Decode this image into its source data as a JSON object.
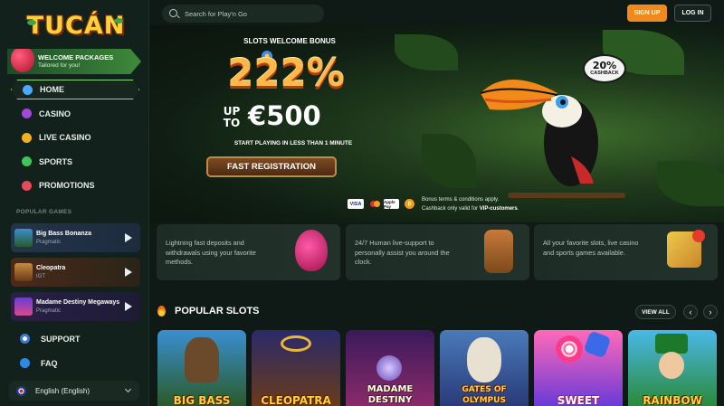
{
  "brand": {
    "name": "TUCÁN"
  },
  "welcome": {
    "title": "WELCOME PACKAGES",
    "subtitle": "Tailored for you!"
  },
  "nav": [
    {
      "label": "HOME",
      "icon": "egg-icon",
      "color": "#4aa8ff"
    },
    {
      "label": "CASINO",
      "icon": "grapes-icon",
      "color": "#a04ad8"
    },
    {
      "label": "LIVE CASINO",
      "icon": "chip-icon",
      "color": "#f0b020"
    },
    {
      "label": "SPORTS",
      "icon": "ball-icon",
      "color": "#3ec45a"
    },
    {
      "label": "PROMOTIONS",
      "icon": "watermelon-icon",
      "color": "#e84a5a"
    }
  ],
  "popular_games_label": "POPULAR GAMES",
  "sidebar_games": [
    {
      "name": "Big Bass Bonanza",
      "provider": "Pragmatic"
    },
    {
      "name": "Cleopatra",
      "provider": "IGT"
    },
    {
      "name": "Madame Destiny Megaways",
      "provider": "Pragmatic"
    }
  ],
  "support": "SUPPORT",
  "faq": "FAQ",
  "language": "English (English)",
  "search": {
    "placeholder": "Search for Play'n Go"
  },
  "header": {
    "signup": "SIGN UP",
    "login": "LOG IN"
  },
  "hero": {
    "title": "SLOTS WELCOME BONUS",
    "percent": "222%",
    "upto": "UP TO",
    "amount": "€500",
    "sub": "START PLAYING IN LESS THAN 1 MINUTE",
    "button": "FAST REGISTRATION",
    "cashback_pct": "20%",
    "cashback_word": "CASHBACK",
    "payments": [
      "VISA",
      "mastercard",
      "Apple Pay",
      "bitcoin"
    ],
    "terms_line1": "Bonus terms & conditions apply.",
    "terms_line2_prefix": "Cashback only valid for ",
    "terms_line2_bold": "VIP-customers",
    "terms_line2_suffix": "."
  },
  "features": [
    {
      "line1": "Lightning fast deposits and",
      "line2": "withdrawals using your favorite",
      "line3": "methods."
    },
    {
      "line1": "24/7 Human live-support to",
      "line2": "personally assist you around the",
      "line3": "clock."
    },
    {
      "line1": "All your favorite slots, live casino",
      "line2": "and sports games available.",
      "line3": ""
    }
  ],
  "slots": {
    "title": "POPULAR SLOTS",
    "view_all": "VIEW ALL",
    "prev": "‹",
    "next": "›",
    "tiles": [
      {
        "title": "BIG BASS",
        "bg": "linear-gradient(#3a8fd0,#2a5a2a)"
      },
      {
        "title": "CLEOPATRA",
        "bg": "linear-gradient(#2a2a6a,#6a3a1a)"
      },
      {
        "title": "MADAME DESTINY",
        "bg": "linear-gradient(#3a1a5a,#8a2a6a)"
      },
      {
        "title": "GATES OF OLYMPUS",
        "bg": "linear-gradient(#4a7ab8,#2a3a7a)"
      },
      {
        "title": "SWEET",
        "bg": "linear-gradient(#ff6ab8,#6a3ad8)"
      },
      {
        "title": "RAINBOW",
        "bg": "linear-gradient(#4ab8e8,#2a8a3a)"
      }
    ]
  }
}
